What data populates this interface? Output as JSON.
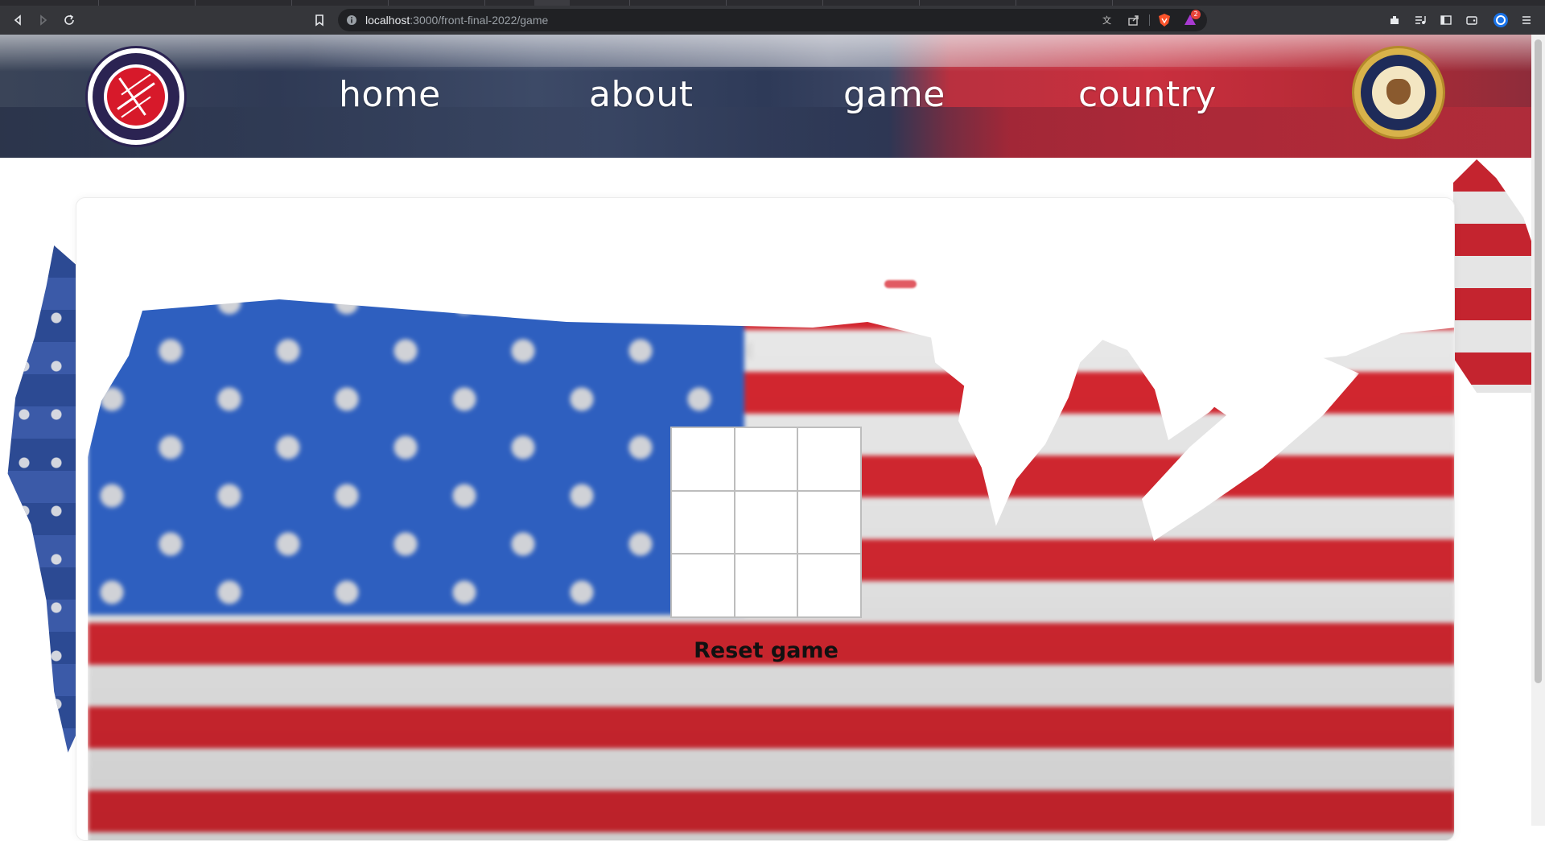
{
  "browser": {
    "url_host": "localhost",
    "url_path": ":3000/front-final-2022/game",
    "notification_count": "2",
    "icons": [
      "back-icon",
      "forward-icon",
      "reload-icon",
      "bookmark-icon",
      "site-info-icon",
      "translate-icon",
      "share-icon",
      "brave-shield-icon",
      "brave-rewards-icon",
      "extensions-icon",
      "media-icon",
      "sidebar-icon",
      "wallet-icon",
      "profile-icon",
      "menu-icon"
    ]
  },
  "header": {
    "nav": [
      {
        "label": "home"
      },
      {
        "label": "about"
      },
      {
        "label": "game"
      },
      {
        "label": "country"
      }
    ],
    "logo_left_alt": "ALA-TOO INTERNATIONAL UNIVERSITY 1996",
    "logo_right_alt": "SEAL OF THE PRESIDENT OF THE UNITED STATES"
  },
  "game": {
    "cells": [
      "",
      "",
      "",
      "",
      "",
      "",
      "",
      "",
      ""
    ],
    "reset_label": "Reset game"
  },
  "colors": {
    "flag_red": "#d4262f",
    "flag_blue": "#2e5fbf",
    "board_border": "#bdbdbd",
    "chrome_bg": "#35363a"
  }
}
